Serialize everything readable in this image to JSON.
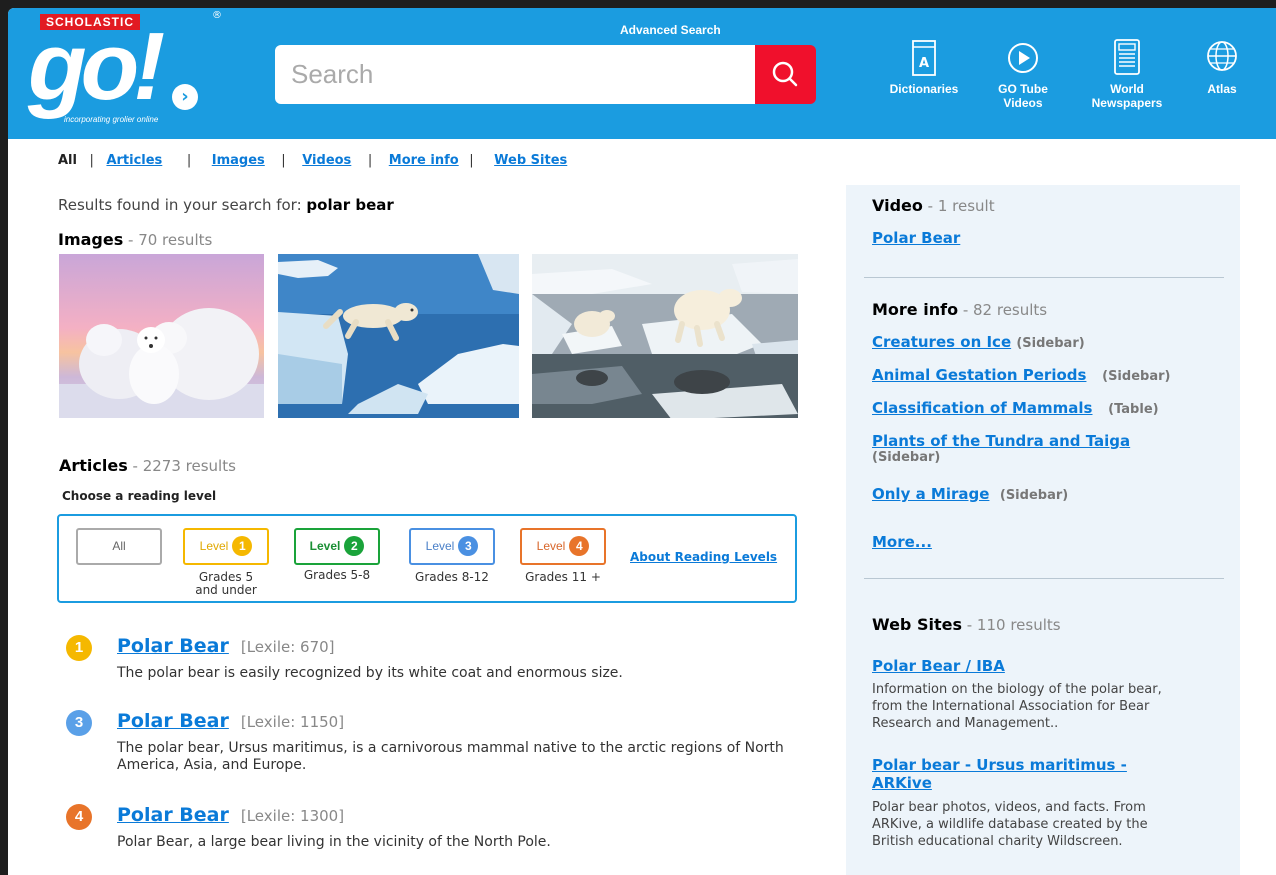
{
  "header": {
    "brand": "SCHOLASTIC",
    "logo_text": "go!",
    "logo_arrow": "›",
    "registered": "®",
    "tagline": "incorporating grolier online",
    "advanced_search": "Advanced Search",
    "search_placeholder": "Search",
    "tools": [
      {
        "label": "Dictionaries",
        "icon": "dictionary-icon"
      },
      {
        "label": "GO Tube Videos",
        "icon": "play-circle-icon"
      },
      {
        "label": "World Newspapers",
        "icon": "newspaper-icon"
      },
      {
        "label": "Atlas",
        "icon": "globe-icon"
      }
    ]
  },
  "filters": {
    "all": "All",
    "articles": "Articles",
    "images": "Images",
    "videos": "Videos",
    "more_info": "More info",
    "web_sites": "Web Sites",
    "separator": "|"
  },
  "results": {
    "prefix": "Results found in your search for: ",
    "query": "polar bear"
  },
  "images": {
    "title": "Images",
    "count": " - 70 results"
  },
  "articles": {
    "title": "Articles",
    "count": " - 2273 results",
    "choose_level": "Choose a reading level",
    "levels": [
      {
        "label": "All",
        "grade": ""
      },
      {
        "label": "Level",
        "num": "1",
        "grade": "Grades 5",
        "grade2": "and under",
        "color": "#f5b800"
      },
      {
        "label": "Level",
        "num": "2",
        "grade": "Grades 5-8",
        "color": "#1aa33a"
      },
      {
        "label": "Level",
        "num": "3",
        "grade": "Grades 8-12",
        "color": "#4a90e2"
      },
      {
        "label": "Level",
        "num": "4",
        "grade": "Grades 11 +",
        "color": "#e8742a"
      }
    ],
    "about_levels": "About Reading Levels",
    "items": [
      {
        "level": "1",
        "title": "Polar Bear",
        "lexile": "[Lexile: 670]",
        "desc": "The polar bear is easily recognized by its white coat and enormous size."
      },
      {
        "level": "3",
        "title": "Polar Bear",
        "lexile": "[Lexile: 1150]",
        "desc": "The polar bear, Ursus maritimus, is a carnivorous mammal native to the arctic regions of North America, Asia, and Europe."
      },
      {
        "level": "4",
        "title": "Polar Bear",
        "lexile": "[Lexile: 1300]",
        "desc": "Polar Bear, a large bear living in the vicinity of the North Pole."
      }
    ]
  },
  "sidebar": {
    "video": {
      "title": "Video",
      "count": " - 1 result",
      "link": "Polar Bear"
    },
    "more_info": {
      "title": "More info",
      "count": " - 82 results",
      "links": [
        {
          "label": "Creatures on Ice",
          "note": "(Sidebar)"
        },
        {
          "label": "Animal Gestation Periods",
          "note": "(Sidebar)"
        },
        {
          "label": "Classification of Mammals",
          "note": "(Table)"
        },
        {
          "label": "Plants of the Tundra and Taiga",
          "note": "(Sidebar)"
        },
        {
          "label": "Only a Mirage",
          "note": "(Sidebar)"
        }
      ],
      "more": "More..."
    },
    "web_sites": {
      "title": "Web Sites",
      "count": " - 110 results",
      "items": [
        {
          "label": "Polar Bear / IBA",
          "desc": "Information on the biology of the polar bear, from the International Association for Bear Research and Management.."
        },
        {
          "label": "Polar bear - Ursus maritimus - ARKive",
          "desc": "Polar bear photos, videos, and facts. From ARKive, a wildlife database created by the British educational charity Wildscreen."
        }
      ]
    }
  }
}
